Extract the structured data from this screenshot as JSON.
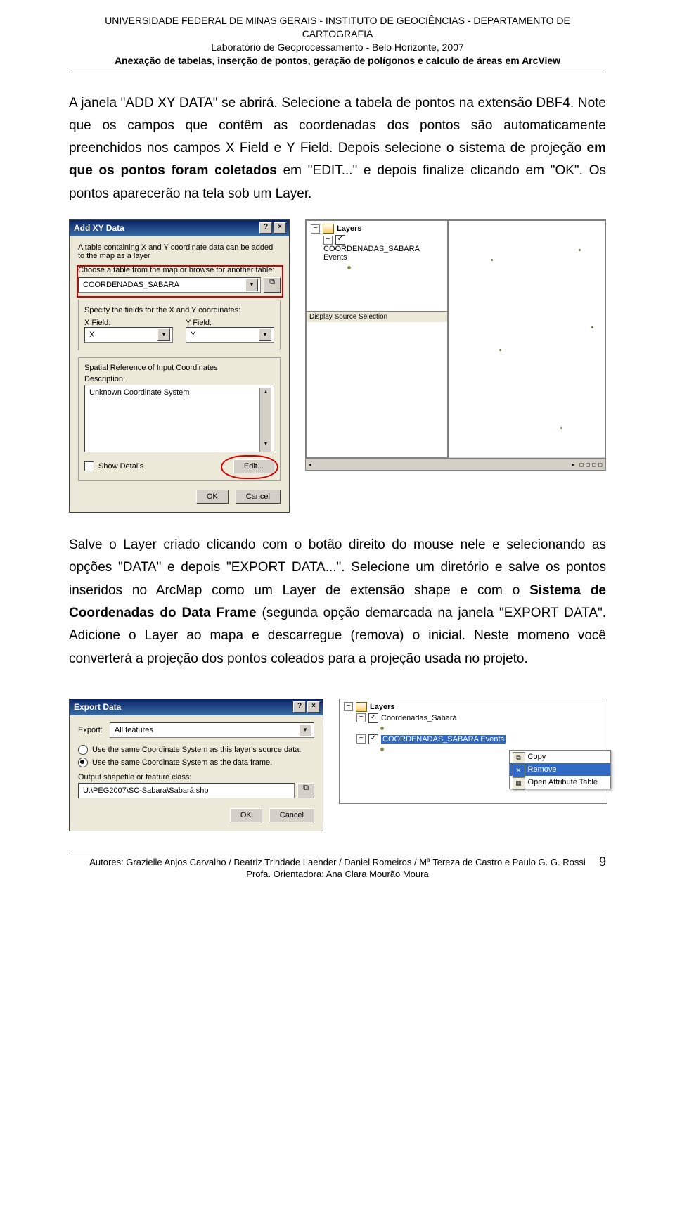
{
  "header": {
    "line1": "UNIVERSIDADE FEDERAL DE MINAS GERAIS - INSTITUTO DE GEOCIÊNCIAS - DEPARTAMENTO DE CARTOGRAFIA",
    "line2": "Laboratório de Geoprocessamento - Belo Horizonte, 2007",
    "line3": "Anexação de tabelas, inserção de pontos, geração de polígonos e calculo de áreas em ArcView"
  },
  "para1": {
    "s1": "A janela \"ADD XY DATA\" se abrirá. Selecione a tabela de pontos na extensão DBF4. Note que os campos que contêm as coordenadas dos pontos são automaticamente preenchidos nos campos X Field e Y Field. Depois selecione o sistema de projeção ",
    "bold1": "em que os pontos foram coletados",
    "s2": " em \"EDIT...\" e depois finalize clicando em \"OK\". Os pontos aparecerão na tela sob um Layer."
  },
  "addxy": {
    "title": "Add XY Data",
    "desc": "A table containing X and Y coordinate data can be added to the map as a layer",
    "choose_label": "Choose a table from the map or browse for another table:",
    "table_value": "COORDENADAS_SABARA",
    "specify_label": "Specify the fields for the X and Y coordinates:",
    "xfield_label": "X Field:",
    "yfield_label": "Y Field:",
    "xfield_value": "X",
    "yfield_value": "Y",
    "sref_label": "Spatial Reference of Input Coordinates",
    "desc_label": "Description:",
    "sref_value": "Unknown Coordinate System",
    "show_details": "Show Details",
    "edit": "Edit...",
    "ok": "OK",
    "cancel": "Cancel"
  },
  "toc1": {
    "layers_label": "Layers",
    "layer1": "COORDENADAS_SABARA Events",
    "tabs": "Display  Source  Selection"
  },
  "para2": {
    "s1": "Salve o Layer criado clicando com o botão direito do mouse nele e selecionando as opções \"DATA\" e depois \"EXPORT DATA...\". Selecione um diretório e salve os pontos inseridos no ArcMap como um Layer de extensão shape e com o ",
    "bold1": "Sistema de Coordenadas do Data Frame",
    "s2": " (segunda opção demarcada na janela \"EXPORT DATA\". Adicione o Layer ao mapa e descarregue (remova) o inicial. Neste momeno você converterá a projeção dos pontos coleados para a projeção usada no projeto."
  },
  "exportdlg": {
    "title": "Export Data",
    "export_label": "Export:",
    "export_value": "All features",
    "opt1": "Use the same Coordinate System as this layer's source data.",
    "opt2": "Use the same Coordinate System as the data frame.",
    "out_label": "Output shapefile or feature class:",
    "out_value": "U:\\PEG2007\\SC-Sabara\\Sabará.shp",
    "ok": "OK",
    "cancel": "Cancel"
  },
  "toc2": {
    "layers_label": "Layers",
    "layer1": "Coordenadas_Sabará",
    "layer2": "COORDENADAS_SABARA Events"
  },
  "ctx": {
    "copy": "Copy",
    "remove": "Remove",
    "open": "Open Attribute Table"
  },
  "footer": {
    "line1": "Autores: Grazielle Anjos Carvalho / Beatriz Trindade Laender / Daniel Romeiros / Mª Tereza de Castro e Paulo G. G. Rossi",
    "line2": "Profa. Orientadora: Ana Clara Mourão Moura",
    "pagenum": "9"
  }
}
